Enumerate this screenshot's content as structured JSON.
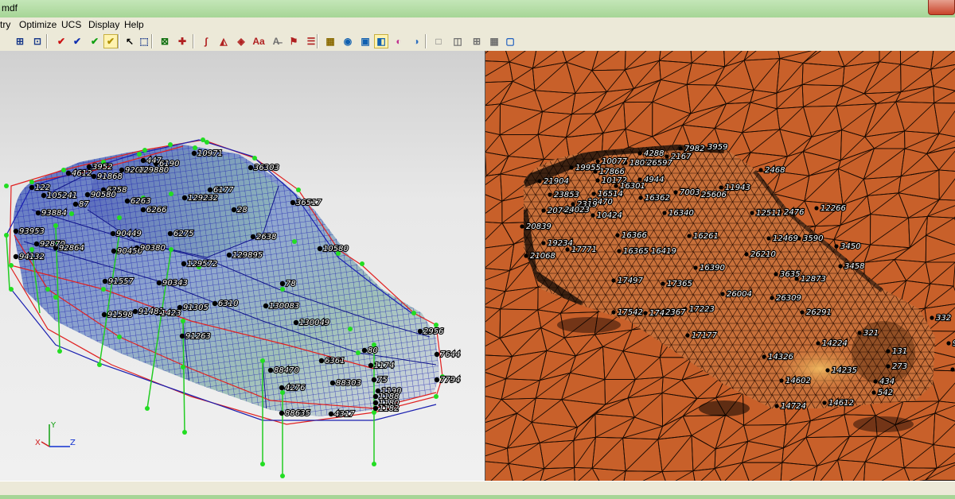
{
  "window": {
    "title": "mdf"
  },
  "menu": [
    {
      "label": "try",
      "key": "menu-geometry"
    },
    {
      "label": "Optimize",
      "key": "menu-optimize"
    },
    {
      "label": "UCS",
      "key": "menu-ucs"
    },
    {
      "label": "Display",
      "key": "menu-display"
    },
    {
      "label": "Help",
      "key": "menu-help"
    }
  ],
  "toolbar": [
    {
      "name": "grid-icon",
      "glyph": "⊞",
      "color": "#1a3a8a"
    },
    {
      "name": "zoom-window-icon",
      "glyph": "⊡",
      "color": "#1a3a8a"
    },
    {
      "name": "check-red-icon",
      "glyph": "✔",
      "color": "#cc1010"
    },
    {
      "name": "check-blue-icon",
      "glyph": "✔",
      "color": "#1030b0"
    },
    {
      "name": "check-green-icon",
      "glyph": "✔",
      "color": "#10a010"
    },
    {
      "name": "check-yellow-icon",
      "glyph": "✔",
      "color": "#b09000",
      "pressed": true
    },
    {
      "name": "select-arrow-icon",
      "glyph": "↖",
      "color": "#000000"
    },
    {
      "name": "select-box-icon",
      "glyph": "⬚",
      "color": "#1a3a8a"
    },
    {
      "name": "add-point-icon",
      "glyph": "⊠",
      "color": "#107010"
    },
    {
      "name": "add-node-icon",
      "glyph": "✚",
      "color": "#b02020"
    },
    {
      "name": "curve-tool-icon",
      "glyph": "∫",
      "color": "#b02020"
    },
    {
      "name": "surface-tool-icon",
      "glyph": "◭",
      "color": "#b02020"
    },
    {
      "name": "shape-tool-icon",
      "glyph": "◈",
      "color": "#b02020"
    },
    {
      "name": "text-label-icon",
      "glyph": "Aa",
      "color": "#b02020"
    },
    {
      "name": "text-off-icon",
      "glyph": "A̶",
      "color": "#707070"
    },
    {
      "name": "flag-tool-icon",
      "glyph": "⚑",
      "color": "#b02020"
    },
    {
      "name": "stack-tool-icon",
      "glyph": "☰",
      "color": "#b02020"
    },
    {
      "name": "mesh-icon",
      "glyph": "▦",
      "color": "#8a6a00"
    },
    {
      "name": "render-icon",
      "glyph": "◉",
      "color": "#1060b0"
    },
    {
      "name": "camera-icon",
      "glyph": "▣",
      "color": "#1060b0"
    },
    {
      "name": "shade-icon",
      "glyph": "◧",
      "color": "#1060b0",
      "pressed": true
    },
    {
      "name": "color-wheel-icon",
      "glyph": "◐",
      "color": "#c03090"
    },
    {
      "name": "palette-icon",
      "glyph": "◑",
      "color": "#3070c0"
    },
    {
      "name": "single-view-icon",
      "glyph": "□",
      "color": "#707070"
    },
    {
      "name": "split-vertical-icon",
      "glyph": "◫",
      "color": "#707070"
    },
    {
      "name": "split-quad-icon",
      "glyph": "⊞",
      "color": "#707070"
    },
    {
      "name": "split-grid-icon",
      "glyph": "▦",
      "color": "#707070"
    },
    {
      "name": "view-focus-icon",
      "glyph": "▢",
      "color": "#2060c0"
    }
  ],
  "axis": {
    "x": "X",
    "y": "Y",
    "z": "Z"
  },
  "colors": {
    "mesh_blue": "#1a1fb0",
    "curve_red": "#e02020",
    "node_green": "#22dd22",
    "background_orange": "#c8602a"
  },
  "left_labels": [
    {
      "t": "10971"
    },
    {
      "t": "4612"
    },
    {
      "t": "3952"
    },
    {
      "t": "92014"
    },
    {
      "t": "129880"
    },
    {
      "t": "447"
    },
    {
      "t": "6190"
    },
    {
      "t": "36303"
    },
    {
      "t": "122"
    },
    {
      "t": "91868"
    },
    {
      "t": "105241"
    },
    {
      "t": "6258"
    },
    {
      "t": "90580"
    },
    {
      "t": "6263"
    },
    {
      "t": "129232"
    },
    {
      "t": "6177"
    },
    {
      "t": "87"
    },
    {
      "t": "36517"
    },
    {
      "t": "93884"
    },
    {
      "t": "6266"
    },
    {
      "t": "28"
    },
    {
      "t": "93953"
    },
    {
      "t": "90449"
    },
    {
      "t": "6275"
    },
    {
      "t": "2638"
    },
    {
      "t": "92870"
    },
    {
      "t": "92864"
    },
    {
      "t": "90456"
    },
    {
      "t": "90380"
    },
    {
      "t": "10580"
    },
    {
      "t": "94132"
    },
    {
      "t": "129895"
    },
    {
      "t": "129572"
    },
    {
      "t": "91557"
    },
    {
      "t": "90343"
    },
    {
      "t": "78"
    },
    {
      "t": "91598"
    },
    {
      "t": "91481"
    },
    {
      "t": "1423"
    },
    {
      "t": "91305"
    },
    {
      "t": "6310"
    },
    {
      "t": "130083"
    },
    {
      "t": "130049"
    },
    {
      "t": "91263"
    },
    {
      "t": "2956"
    },
    {
      "t": "80"
    },
    {
      "t": "7644"
    },
    {
      "t": "6361"
    },
    {
      "t": "1174"
    },
    {
      "t": "88470"
    },
    {
      "t": "75"
    },
    {
      "t": "7794"
    },
    {
      "t": "4276"
    },
    {
      "t": "88303"
    },
    {
      "t": "1190"
    },
    {
      "t": "1188"
    },
    {
      "t": "1180"
    },
    {
      "t": "1182"
    },
    {
      "t": "88635"
    },
    {
      "t": "4317"
    }
  ],
  "right_labels": [
    {
      "t": "4288"
    },
    {
      "t": "7982"
    },
    {
      "t": "3959"
    },
    {
      "t": "2167"
    },
    {
      "t": "10077"
    },
    {
      "t": "18079"
    },
    {
      "t": "26597"
    },
    {
      "t": "19955"
    },
    {
      "t": "17866"
    },
    {
      "t": "2468"
    },
    {
      "t": "21904"
    },
    {
      "t": "10172"
    },
    {
      "t": "4944"
    },
    {
      "t": "16301"
    },
    {
      "t": "7003"
    },
    {
      "t": "11943"
    },
    {
      "t": "23853"
    },
    {
      "t": "16514"
    },
    {
      "t": "25606"
    },
    {
      "t": "18470"
    },
    {
      "t": "2319"
    },
    {
      "t": "16362"
    },
    {
      "t": "20742"
    },
    {
      "t": "24023"
    },
    {
      "t": "10424"
    },
    {
      "t": "16340"
    },
    {
      "t": "12511"
    },
    {
      "t": "2476"
    },
    {
      "t": "12266"
    },
    {
      "t": "20839"
    },
    {
      "t": "16366"
    },
    {
      "t": "16261"
    },
    {
      "t": "12469"
    },
    {
      "t": "3590"
    },
    {
      "t": "19234"
    },
    {
      "t": "17771"
    },
    {
      "t": "16365"
    },
    {
      "t": "16419"
    },
    {
      "t": "3450"
    },
    {
      "t": "21068"
    },
    {
      "t": "26210"
    },
    {
      "t": "16390"
    },
    {
      "t": "3458"
    },
    {
      "t": "3635"
    },
    {
      "t": "12873"
    },
    {
      "t": "17497"
    },
    {
      "t": "17365"
    },
    {
      "t": "26004"
    },
    {
      "t": "26309"
    },
    {
      "t": "17542"
    },
    {
      "t": "17422"
    },
    {
      "t": "2367"
    },
    {
      "t": "17223"
    },
    {
      "t": "26291"
    },
    {
      "t": "332"
    },
    {
      "t": "17177"
    },
    {
      "t": "321"
    },
    {
      "t": "14224"
    },
    {
      "t": "992"
    },
    {
      "t": "131"
    },
    {
      "t": "14326"
    },
    {
      "t": "273"
    },
    {
      "t": "14235"
    },
    {
      "t": "955"
    },
    {
      "t": "14602"
    },
    {
      "t": "434"
    },
    {
      "t": "542"
    },
    {
      "t": "14724"
    },
    {
      "t": "14612"
    }
  ]
}
